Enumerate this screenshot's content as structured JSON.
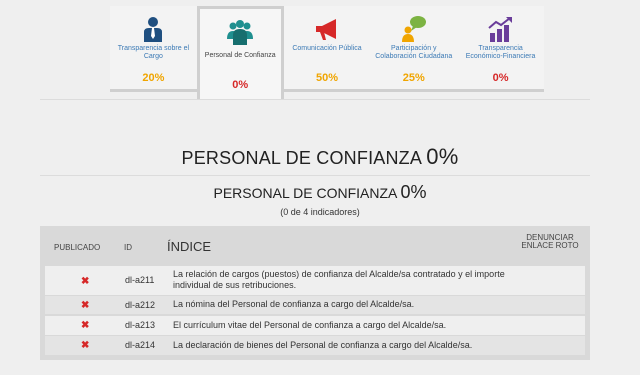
{
  "tabs": [
    {
      "label": "Transparencia sobre el Cargo",
      "percent": "20%",
      "color": "#f0a500",
      "icon": "person-tie-icon",
      "icon_color": "#1f4f80"
    },
    {
      "label": "Personal de Confianza",
      "percent": "0%",
      "color": "#d62828",
      "icon": "group-icon",
      "icon_color": "#1f8f8f"
    },
    {
      "label": "Comunicación Pública",
      "percent": "50%",
      "color": "#f0a500",
      "icon": "megaphone-icon",
      "icon_color": "#d62828"
    },
    {
      "label": "Participación y Colaboración Ciudadana",
      "percent": "25%",
      "color": "#f0a500",
      "icon": "person-speech-icon",
      "icon_color": "#7cb342"
    },
    {
      "label": "Transparencia Económico-Financiera",
      "percent": "0%",
      "color": "#d62828",
      "icon": "bar-chart-icon",
      "icon_color": "#6a3d9a"
    }
  ],
  "heading": {
    "title": "PERSONAL DE CONFIANZA",
    "percent": "0%"
  },
  "subheading": {
    "title": "PERSONAL DE CONFIANZA",
    "percent": "0%",
    "note": "(0 de 4 indicadores)"
  },
  "table": {
    "headers": {
      "published": "PUBLICADO",
      "id": "ID",
      "index": "ÍNDICE",
      "report": "DENUNCIAR ENLACE ROTO"
    },
    "rows": [
      {
        "published": "✖",
        "id": "dl-a211",
        "text": "La relación de cargos (puestos) de confianza del Alcalde/sa contratado y el importe individual de sus retribuciones."
      },
      {
        "published": "✖",
        "id": "dl-a212",
        "text": "La nómina del Personal de confianza a cargo del Alcalde/sa."
      },
      {
        "published": "✖",
        "id": "dl-a213",
        "text": "El currículum vitae del Personal de confianza a cargo del Alcalde/sa."
      },
      {
        "published": "✖",
        "id": "dl-a214",
        "text": "La declaración de bienes del Personal de confianza a cargo del Alcalde/sa."
      }
    ]
  }
}
